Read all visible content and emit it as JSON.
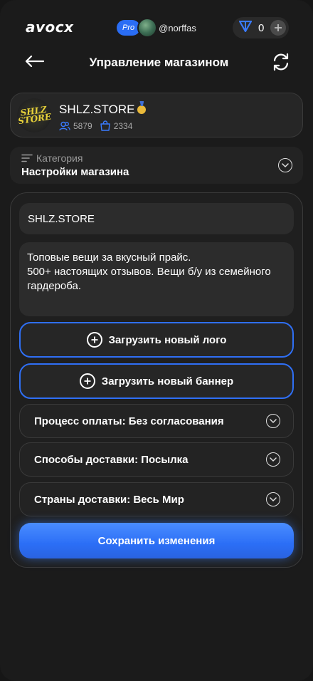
{
  "topbar": {
    "logo": "avocx",
    "pro_badge": "Pro",
    "username": "@norffas",
    "wallet_count": "0",
    "icons": [
      "diamond-icon",
      "plus-icon"
    ]
  },
  "header": {
    "title": "Управление магазином",
    "icons": [
      "arrow-left-icon",
      "refresh-icon"
    ]
  },
  "store": {
    "name": "SHLZ.STORE",
    "logo_text": "SHLZ STORE",
    "followers": "5879",
    "orders": "2334"
  },
  "category": {
    "label": "Категория",
    "value": "Настройки магазина"
  },
  "form": {
    "store_name_value": "SHLZ.STORE",
    "description_value": "Топовые вещи за вкусный прайс.\n500+ настоящих отзывов. Вещи б/у из семейного гардероба.",
    "upload_logo_label": "Загрузить новый лого",
    "upload_banner_label": "Загрузить новый баннер",
    "payment_label": "Процесс оплаты: Без согласования",
    "delivery_label": "Способы доставки: Посылка",
    "countries_label": "Страны доставки: Весь Мир",
    "save_label": "Сохранить изменения"
  },
  "colors": {
    "background": "#1b1b1b",
    "card": "#262626",
    "accent": "#2f6ff5",
    "pro_badge": "#2a6df4"
  }
}
